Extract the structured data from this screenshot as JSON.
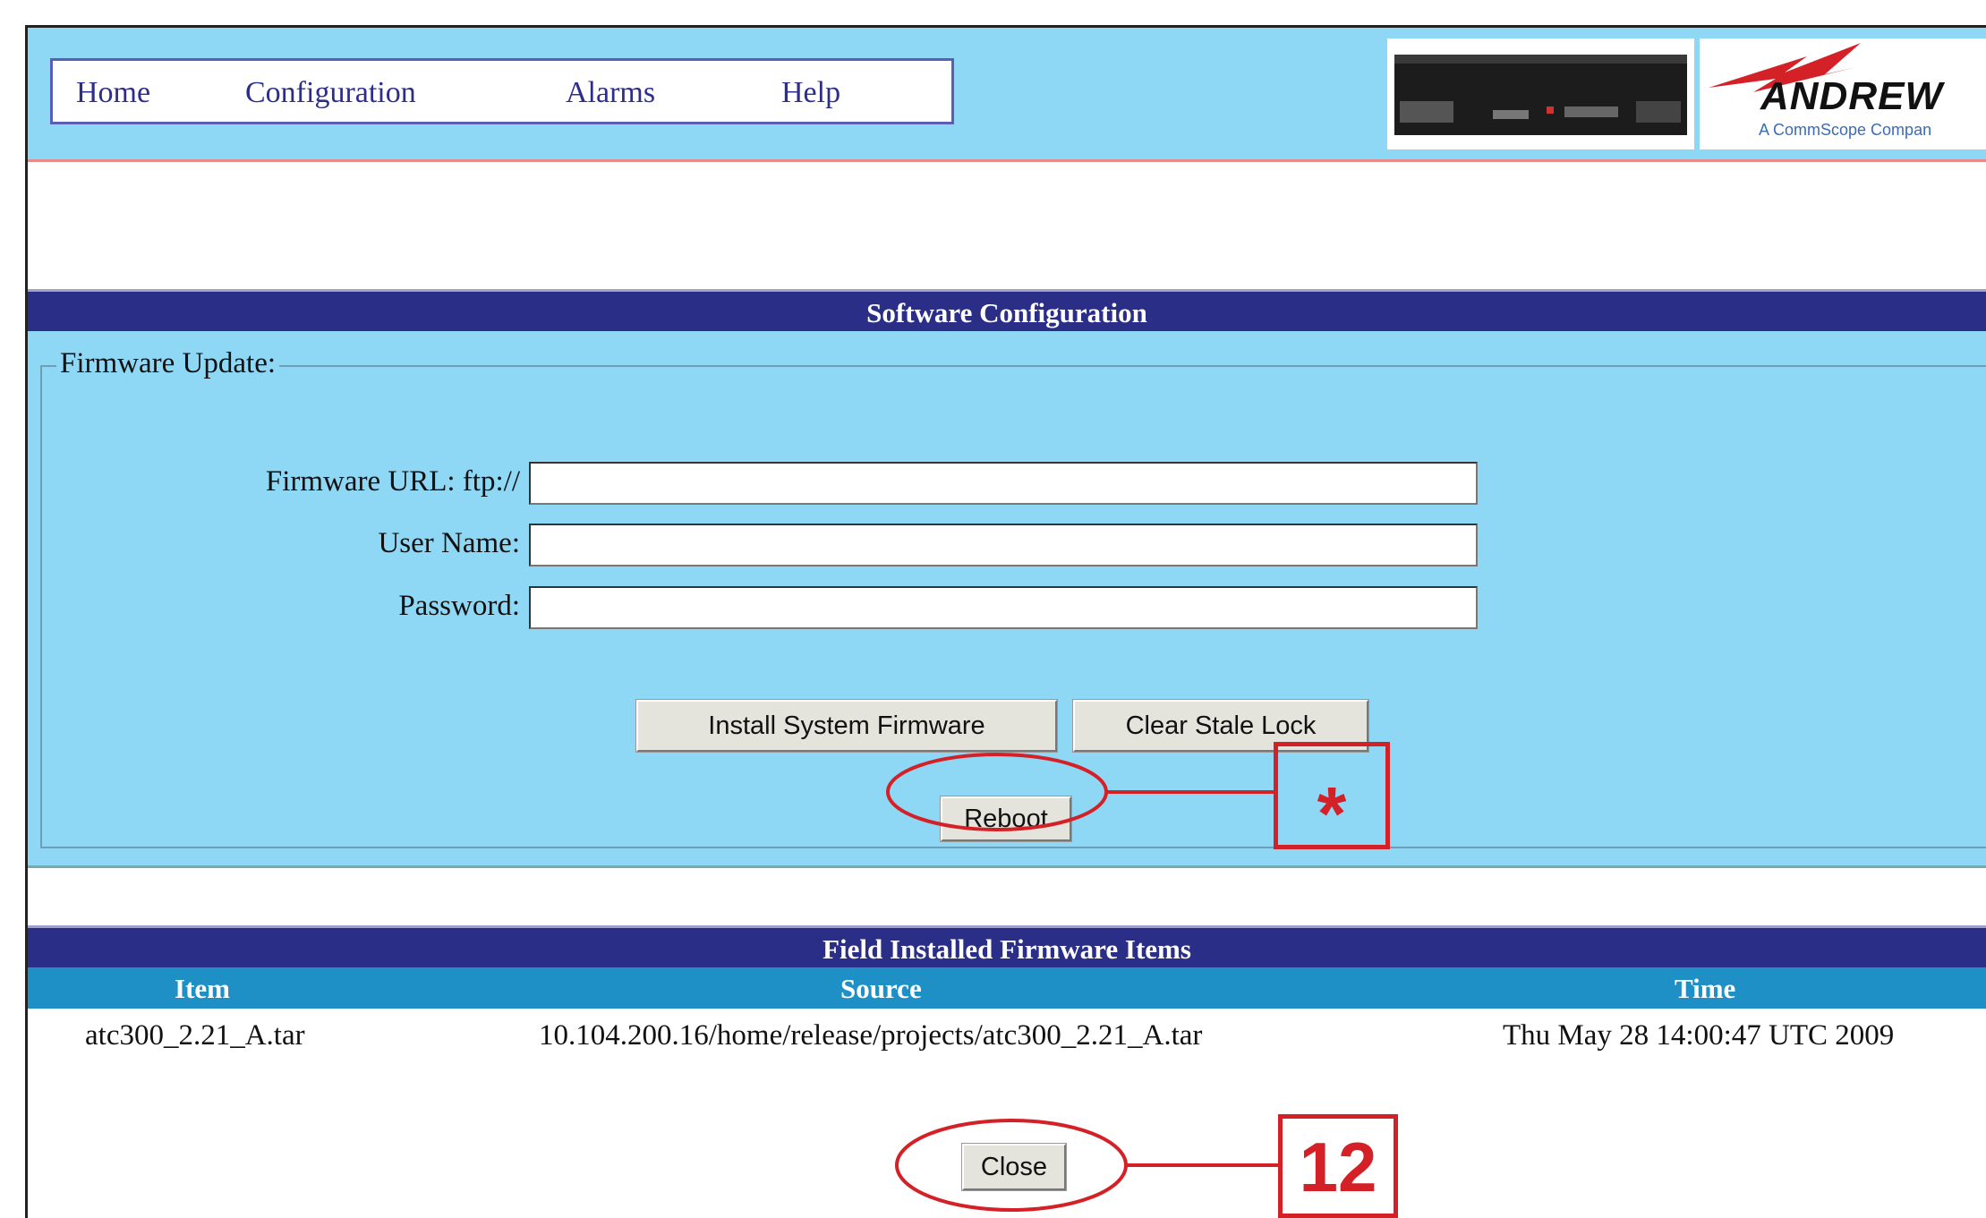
{
  "nav": {
    "home": "Home",
    "configuration": "Configuration",
    "alarms": "Alarms",
    "help": "Help"
  },
  "logo": {
    "name": "ANDREW",
    "tagline": "A CommScope Compan"
  },
  "software_section": {
    "title": "Software Configuration",
    "group_legend": "Firmware Update:",
    "url_label": "Firmware URL: ftp://",
    "user_label": "User Name:",
    "password_label": "Password:",
    "url_value": "",
    "user_value": "",
    "password_value": "",
    "install_button": "Install System Firmware",
    "clear_button": "Clear Stale Lock",
    "reboot_button": "Reboot"
  },
  "firmware_section": {
    "title": "Field Installed Firmware Items",
    "columns": [
      "Item",
      "Source",
      "Time"
    ],
    "rows": [
      {
        "item": "atc300_2.21_A.tar",
        "source": "10.104.200.16/home/release/projects/atc300_2.21_A.tar",
        "time": "Thu May 28 14:00:47 UTC 2009"
      }
    ],
    "close_button": "Close"
  },
  "annotations": {
    "reboot_callout": "*",
    "close_callout": "12"
  },
  "colors": {
    "header_bg": "#8fd8f5",
    "section_bar": "#2b2e86",
    "column_header": "#1e90c6",
    "callout_red": "#d42127"
  }
}
